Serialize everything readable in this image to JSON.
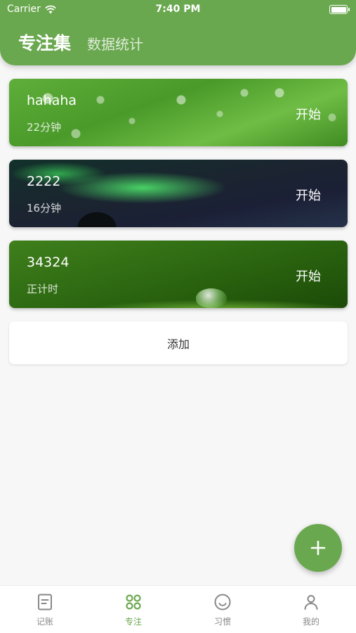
{
  "status_bar": {
    "carrier": "Carrier",
    "time": "7:40 PM"
  },
  "header": {
    "active_tab": "专注集",
    "inactive_tab": "数据统计",
    "color": "#6aa84f"
  },
  "cards": [
    {
      "title": "hahaha",
      "duration": "22分钟",
      "start_label": "开始",
      "background": "green leaf with water drops"
    },
    {
      "title": "2222",
      "duration": "16分钟",
      "start_label": "开始",
      "background": "aurora night sky"
    },
    {
      "title": "34324",
      "duration": "正计时",
      "start_label": "开始",
      "background": "green leaf with droplet"
    }
  ],
  "add_button": {
    "label": "添加"
  },
  "fab": {
    "icon": "plus-icon"
  },
  "tabbar": {
    "items": [
      {
        "label": "记账",
        "icon": "ledger-icon",
        "active": false
      },
      {
        "label": "专注",
        "icon": "grid-icon",
        "active": true
      },
      {
        "label": "习惯",
        "icon": "smile-icon",
        "active": false
      },
      {
        "label": "我的",
        "icon": "user-icon",
        "active": false
      }
    ],
    "active_color": "#6aa84f",
    "inactive_color": "#888888"
  }
}
